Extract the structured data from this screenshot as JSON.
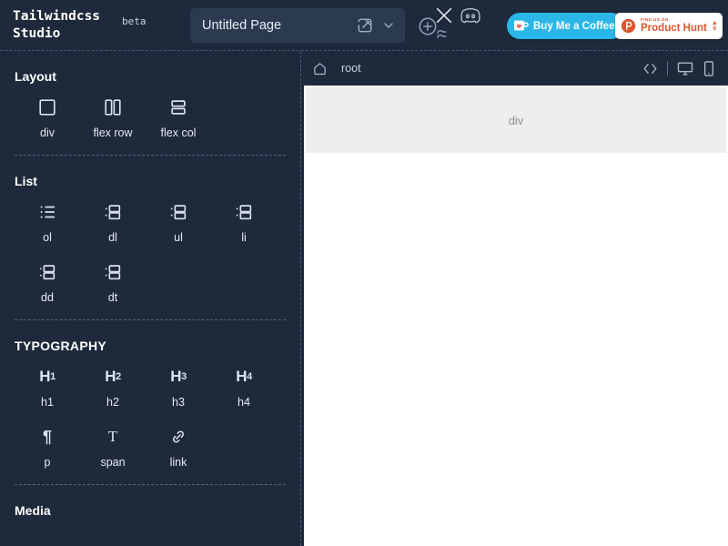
{
  "app": {
    "brand_line1": "Tailwindcss",
    "brand_line2": "Studio",
    "beta_badge": "beta"
  },
  "topbar": {
    "page_title_value": "Untitled Page",
    "page_title_placeholder": "Untitled Page",
    "edit_icon": "edit-pencil-square-icon",
    "chevron_icon": "chevron-down-icon",
    "add_icon": "plus-circle-icon",
    "twitter_icon": "x-twitter-icon",
    "tailwind_icon": "tailwind-wave-icon",
    "discord_icon": "discord-icon",
    "buy_me_a_coffee": {
      "label": "Buy Me a Coffee",
      "icon": "coffee-cup-icon",
      "bg_color": "#2ab7e8",
      "text_color": "#ffffff"
    },
    "product_hunt": {
      "kicker": "FIND US ON",
      "label": "Product Hunt",
      "icon": "product-hunt-logo-icon",
      "upvote_arrow": "▲",
      "upvote_count": "6",
      "bg_color": "#ffffff",
      "brand_color": "#da552f"
    }
  },
  "sidebar": {
    "sections": [
      {
        "title": "Layout",
        "items": [
          {
            "label": "div",
            "icon": "square-outline-icon"
          },
          {
            "label": "flex row",
            "icon": "columns-two-icon"
          },
          {
            "label": "flex col",
            "icon": "rows-two-icon"
          }
        ]
      },
      {
        "title": "List",
        "items": [
          {
            "label": "ol",
            "icon": "list-ordered-icon"
          },
          {
            "label": "dl",
            "icon": "list-details-icon"
          },
          {
            "label": "ul",
            "icon": "list-details-icon"
          },
          {
            "label": "li",
            "icon": "list-details-icon"
          },
          {
            "label": "dd",
            "icon": "list-details-icon"
          },
          {
            "label": "dt",
            "icon": "list-details-icon"
          }
        ]
      },
      {
        "title": "TYPOGRAPHY",
        "items": [
          {
            "label": "h1",
            "icon": "heading-1-icon",
            "glyph": "H",
            "sub": "1"
          },
          {
            "label": "h2",
            "icon": "heading-2-icon",
            "glyph": "H",
            "sub": "2"
          },
          {
            "label": "h3",
            "icon": "heading-3-icon",
            "glyph": "H",
            "sub": "3"
          },
          {
            "label": "h4",
            "icon": "heading-4-icon",
            "glyph": "H",
            "sub": "4"
          },
          {
            "label": "p",
            "icon": "paragraph-icon",
            "glyph": "¶"
          },
          {
            "label": "span",
            "icon": "text-span-icon",
            "glyph": "T"
          },
          {
            "label": "link",
            "icon": "link-chain-icon"
          }
        ]
      },
      {
        "title": "Media",
        "items": []
      }
    ]
  },
  "canvas": {
    "breadcrumb_home_icon": "home-icon",
    "breadcrumb_label": "root",
    "code_icon": "code-brackets-icon",
    "desktop_icon": "desktop-monitor-icon",
    "mobile_icon": "mobile-device-icon",
    "blocks": [
      {
        "label": "div",
        "bg_color": "#eeeeee",
        "text_color": "#8b8f96"
      }
    ]
  },
  "colors": {
    "app_background": "#1e293b",
    "panel_background": "#2c3a50",
    "canvas_background": "#ffffff",
    "dashed_border": "#4b5a72"
  }
}
